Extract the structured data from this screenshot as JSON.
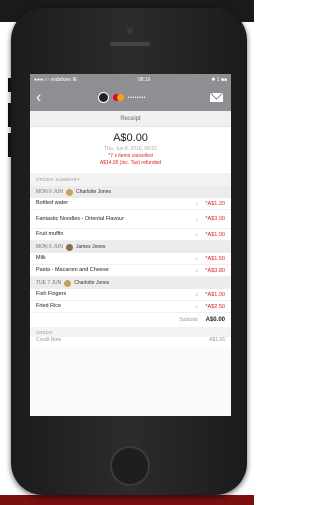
{
  "status_bar": {
    "carrier": "●●●○○ vodafone IE",
    "time": "08:16",
    "battery": "✱ 1 ■■"
  },
  "nav": {
    "back_icon": "chevron-left",
    "card_digits": "••••••••",
    "mail_icon": "envelope"
  },
  "receipt": {
    "title": "Receipt",
    "amount": "A$0.00",
    "date": "Thu, Jun 8, 2016, 09:52",
    "cancel_note": "*7 x items cancelled",
    "refund_note": "A$14.00 (inc. Tax) refunded"
  },
  "order_summary_label": "ORDER SUMMARY",
  "groups": [
    {
      "day": "MON 6 JUN",
      "person": "Charlotte Jones",
      "items": [
        {
          "name": "Bottled water",
          "qty": "1",
          "price": "*A$1.20"
        },
        {
          "name": "Fantastic Noodles - Oriental Flavour",
          "qty": "1",
          "price": "*A$3.00"
        },
        {
          "name": "Fruit muffin",
          "qty": "1",
          "price": "*A$1.00"
        }
      ]
    },
    {
      "day": "MON 6 JUN",
      "person": "James Jones",
      "items": [
        {
          "name": "Milk",
          "qty": "1",
          "price": "*A$1.50"
        },
        {
          "name": "Pasta - Macaroni and Cheese",
          "qty": "1",
          "price": "*A$3.80"
        }
      ]
    },
    {
      "day": "TUE 7 JUN",
      "person": "Charlotte Jones",
      "items": [
        {
          "name": "Fish Fingers",
          "qty": "1",
          "price": "*A$1.00"
        },
        {
          "name": "Fried Rice",
          "qty": "1",
          "price": "*A$2.50"
        }
      ]
    }
  ],
  "subtotal": {
    "label": "Subtotal",
    "value": "A$0.00"
  },
  "credit_label": "CREDIT",
  "credit_row": {
    "name": "Credit Note",
    "value": "A$1.06"
  },
  "colors": {
    "accent_red": "#e02020",
    "header_gray": "#8f8f93"
  }
}
